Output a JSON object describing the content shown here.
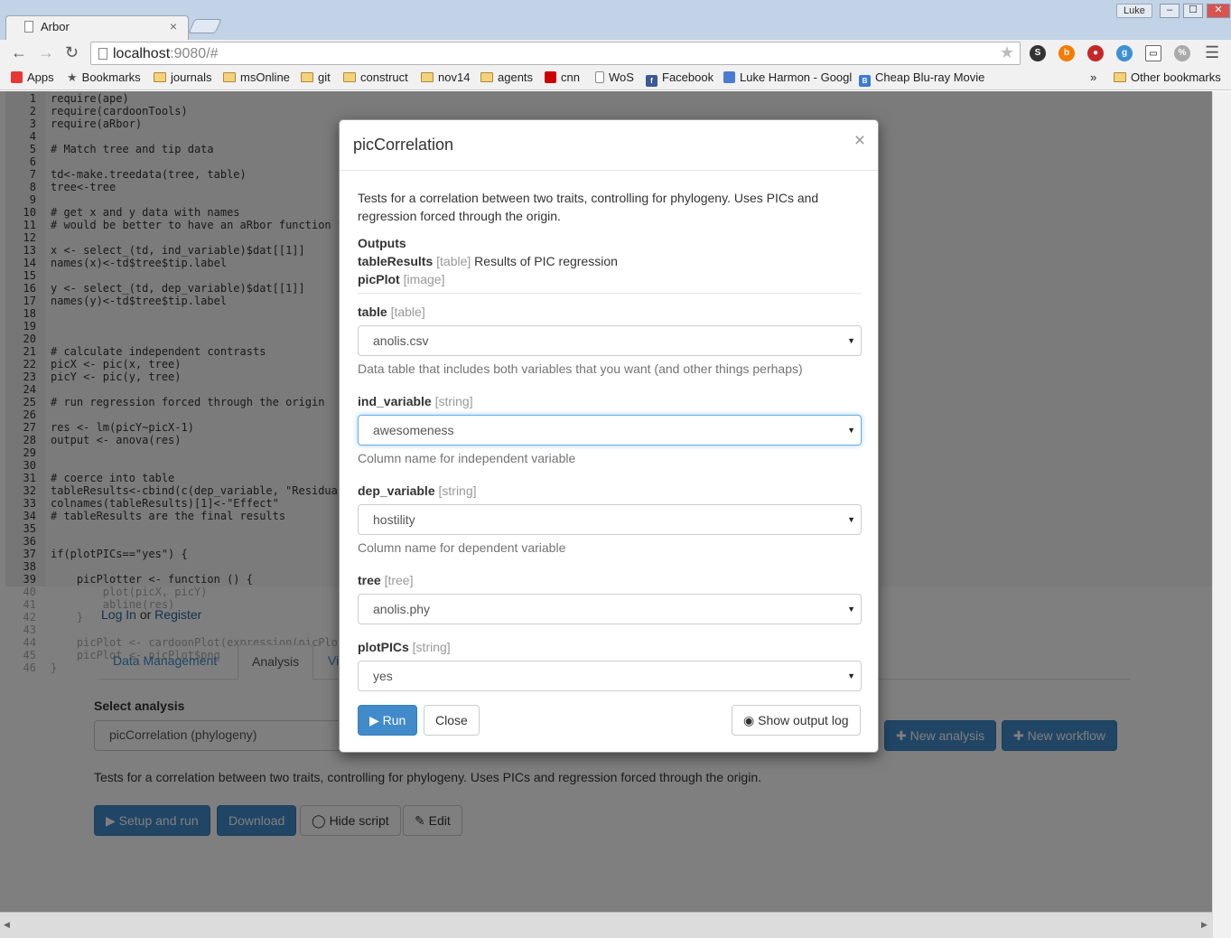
{
  "browser": {
    "tab_title": "Arbor",
    "tab_close": "×",
    "profile_name": "Luke",
    "url_host": "localhost",
    "url_rest": ":9080/#",
    "window_controls": [
      "–",
      "☐",
      "✕"
    ],
    "bookmarks": [
      {
        "label": "Apps",
        "icon": "apps-grid-icon"
      },
      {
        "label": "Bookmarks",
        "icon": "star-icon"
      },
      {
        "label": "journals",
        "icon": "folder-icon"
      },
      {
        "label": "msOnline",
        "icon": "folder-icon"
      },
      {
        "label": "git",
        "icon": "folder-icon"
      },
      {
        "label": "construct",
        "icon": "folder-icon"
      },
      {
        "label": "nov14",
        "icon": "folder-icon"
      },
      {
        "label": "agents",
        "icon": "folder-icon"
      },
      {
        "label": "cnn",
        "icon": "cnn-icon"
      },
      {
        "label": "WoS",
        "icon": "page-icon"
      },
      {
        "label": "Facebook",
        "icon": "facebook-icon"
      },
      {
        "label": "Luke Harmon - Googl",
        "icon": "scholar-icon"
      },
      {
        "label": "Cheap Blu-ray Movie",
        "icon": "b-icon"
      }
    ],
    "bookmarks_overflow": "»",
    "other_bookmarks": "Other bookmarks"
  },
  "editor": {
    "lines": [
      {
        "n": "1",
        "code": "require(ape)"
      },
      {
        "n": "2",
        "code": "require(cardoonTools)"
      },
      {
        "n": "3",
        "code": "require(aRbor)"
      },
      {
        "n": "4",
        "code": ""
      },
      {
        "n": "5",
        "code": "# Match tree and tip data"
      },
      {
        "n": "6",
        "code": ""
      },
      {
        "n": "7",
        "code": "td<-make.treedata(tree, table)"
      },
      {
        "n": "8",
        "code": "tree<-tree"
      },
      {
        "n": "9",
        "code": ""
      },
      {
        "n": "10",
        "code": "# get x and y data with names"
      },
      {
        "n": "11",
        "code": "# would be better to have an aRbor function th"
      },
      {
        "n": "12",
        "code": ""
      },
      {
        "n": "13",
        "code": "x <- select_(td, ind_variable)$dat[[1]]"
      },
      {
        "n": "14",
        "code": "names(x)<-td$tree$tip.label"
      },
      {
        "n": "15",
        "code": ""
      },
      {
        "n": "16",
        "code": "y <- select_(td, dep_variable)$dat[[1]]"
      },
      {
        "n": "17",
        "code": "names(y)<-td$tree$tip.label"
      },
      {
        "n": "18",
        "code": ""
      },
      {
        "n": "19",
        "code": ""
      },
      {
        "n": "20",
        "code": ""
      },
      {
        "n": "21",
        "code": "# calculate independent contrasts"
      },
      {
        "n": "22",
        "code": "picX <- pic(x, tree)"
      },
      {
        "n": "23",
        "code": "picY <- pic(y, tree)"
      },
      {
        "n": "24",
        "code": ""
      },
      {
        "n": "25",
        "code": "# run regression forced through the origin"
      },
      {
        "n": "26",
        "code": ""
      },
      {
        "n": "27",
        "code": "res <- lm(picY~picX-1)"
      },
      {
        "n": "28",
        "code": "output <- anova(res)"
      },
      {
        "n": "29",
        "code": ""
      },
      {
        "n": "30",
        "code": ""
      },
      {
        "n": "31",
        "code": "# coerce into table"
      },
      {
        "n": "32",
        "code": "tableResults<-cbind(c(dep_variable, \"Residuals"
      },
      {
        "n": "33",
        "code": "colnames(tableResults)[1]<-\"Effect\""
      },
      {
        "n": "34",
        "code": "# tableResults are the final results"
      },
      {
        "n": "35",
        "code": ""
      },
      {
        "n": "36",
        "code": ""
      },
      {
        "n": "37",
        "code": "if(plotPICs==\"yes\") {"
      },
      {
        "n": "38",
        "code": ""
      },
      {
        "n": "39",
        "code": "    picPlotter <- function () {"
      }
    ],
    "faded_lines": [
      {
        "n": "40",
        "code": "        plot(picX, picY)"
      },
      {
        "n": "41",
        "code": "        abline(res)"
      },
      {
        "n": "42",
        "code": "    }"
      },
      {
        "n": "43",
        "code": ""
      },
      {
        "n": "44",
        "code": "    picPlot <- cardoonPlot(expression(picPlot"
      },
      {
        "n": "45",
        "code": "    picPlot <- picPlot$png"
      },
      {
        "n": "46",
        "code": "}"
      }
    ]
  },
  "app": {
    "login": "Log In",
    "or": "or",
    "register": "Register",
    "tabs": [
      "Data Management",
      "Analysis",
      "Vi"
    ],
    "select_label": "Select analysis",
    "select_value": "picCorrelation (phylogeny)",
    "new_analysis": "New analysis",
    "new_workflow": "New workflow",
    "description": "Tests for a correlation between two traits, controlling for phylogeny. Uses PICs and regression forced through the origin.",
    "setup_run": "Setup and run",
    "download": "Download",
    "hide_script": "Hide script",
    "edit": "Edit"
  },
  "modal": {
    "title": "picCorrelation",
    "close_x": "×",
    "description_1": "Tests for a correlation between two traits, controlling for phylogeny. Uses PICs and",
    "description_2": "regression forced through the origin.",
    "outputs_heading": "Outputs",
    "outputs": [
      {
        "name": "tableResults",
        "type": "[table]",
        "desc": "Results of PIC regression"
      },
      {
        "name": "picPlot",
        "type": "[image]",
        "desc": ""
      }
    ],
    "fields": [
      {
        "name": "table",
        "type": "[table]",
        "value": "anolis.csv",
        "help": "Data table that includes both variables that you want (and other things perhaps)"
      },
      {
        "name": "ind_variable",
        "type": "[string]",
        "value": "awesomeness",
        "help": "Column name for independent variable"
      },
      {
        "name": "dep_variable",
        "type": "[string]",
        "value": "hostility",
        "help": "Column name for dependent variable"
      },
      {
        "name": "tree",
        "type": "[tree]",
        "value": "anolis.phy",
        "help": ""
      },
      {
        "name": "plotPICs",
        "type": "[string]",
        "value": "yes",
        "help": ""
      }
    ],
    "run": "Run",
    "close": "Close",
    "show_log": "Show output log"
  }
}
